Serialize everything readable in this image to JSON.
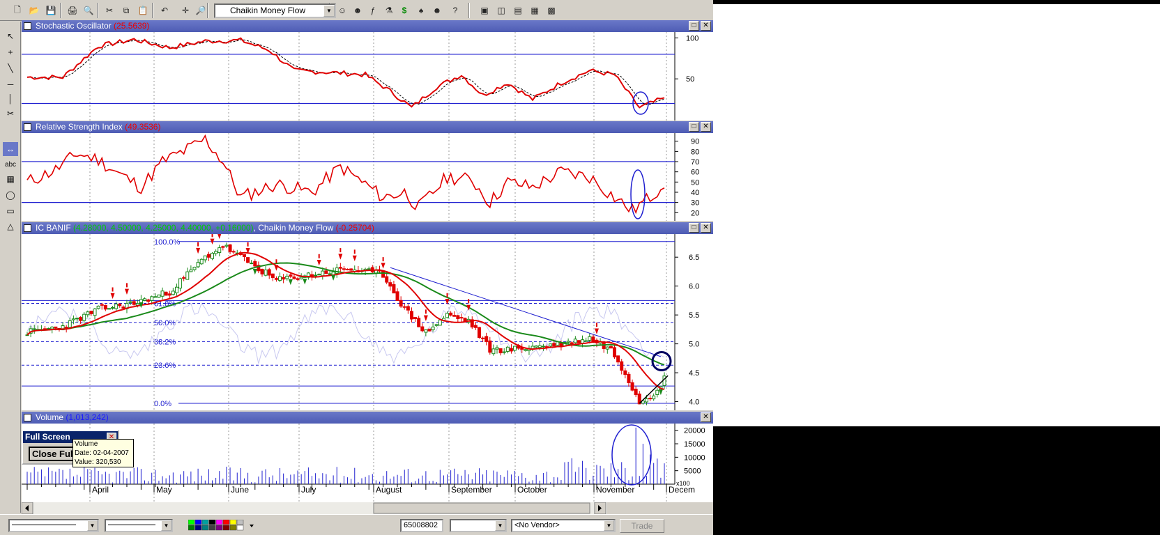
{
  "toolbar": {
    "indicator_combo": "Chaikin Money Flow",
    "icons": [
      "new-icon",
      "open-icon",
      "save-icon",
      "print-icon",
      "print-preview-icon",
      "cut-icon",
      "copy-icon",
      "paste-icon",
      "undo-icon",
      "crosshair-icon",
      "zoom-icon",
      "indicator-builder-icon",
      "expert-icon",
      "function-icon",
      "system-tester-icon",
      "dollar-icon",
      "explorer-icon",
      "people-icon",
      "help-icon",
      "cascade-icon",
      "tile-vertical-icon",
      "tile-horizontal-icon",
      "tile-icon",
      "dashboard-icon"
    ]
  },
  "left_tools": [
    "pointer-icon",
    "cross-icon",
    "trendline-icon",
    "horizontal-line-icon",
    "vertical-line-icon",
    "split-icon",
    "scroll-icon",
    "text-icon",
    "grid-icon",
    "ellipse-icon",
    "rectangle-icon",
    "triangle-icon"
  ],
  "left_text_tool": "abc",
  "panes": {
    "stoch": {
      "title": "Stochastic Oscillator",
      "value": "(25.5639)",
      "yticks": [
        "100",
        "50"
      ]
    },
    "rsi": {
      "title": "Relative Strength Index",
      "value": "(49.3536)",
      "yticks": [
        "90",
        "80",
        "70",
        "60",
        "50",
        "40",
        "30",
        "20"
      ]
    },
    "price": {
      "title_prefix": "IC BANIF",
      "ohlc": "(4.28000, 4.50000, 4.25000, 4.40000, +0.16000)",
      "sep": ",",
      "indicator": "Chaikin Money Flow",
      "indicator_value": "(-0.25704)",
      "yticks": [
        "6.5",
        "6.0",
        "5.5",
        "5.0",
        "4.5",
        "4.0"
      ],
      "fib_levels": [
        "100.0%",
        "61.8%",
        "50.0%",
        "38.2%",
        "23.6%",
        "0.0%"
      ]
    },
    "volume": {
      "title": "Volume",
      "value": "(1,013,242)",
      "yticks": [
        "20000",
        "15000",
        "10000",
        "5000"
      ],
      "multiplier": "x100"
    }
  },
  "months": [
    "April",
    "May",
    "June",
    "July",
    "August",
    "September",
    "October",
    "November",
    "Decem"
  ],
  "full_screen_dialog": {
    "title": "Full Screen",
    "button": "Close Full"
  },
  "tooltip": {
    "line1": "Volume",
    "line2": "Date: 02-04-2007",
    "line3": "Value: 320,530"
  },
  "bottom": {
    "symbol_field": "65008802",
    "vendor": "<No Vendor>",
    "trade": "Trade"
  },
  "colors": {
    "title_bar": "#4e5cb4",
    "stoch_line": "#e00000",
    "band_line": "#2020d0",
    "ma_red": "#e00000",
    "ma_green": "#1a8a1a"
  }
}
